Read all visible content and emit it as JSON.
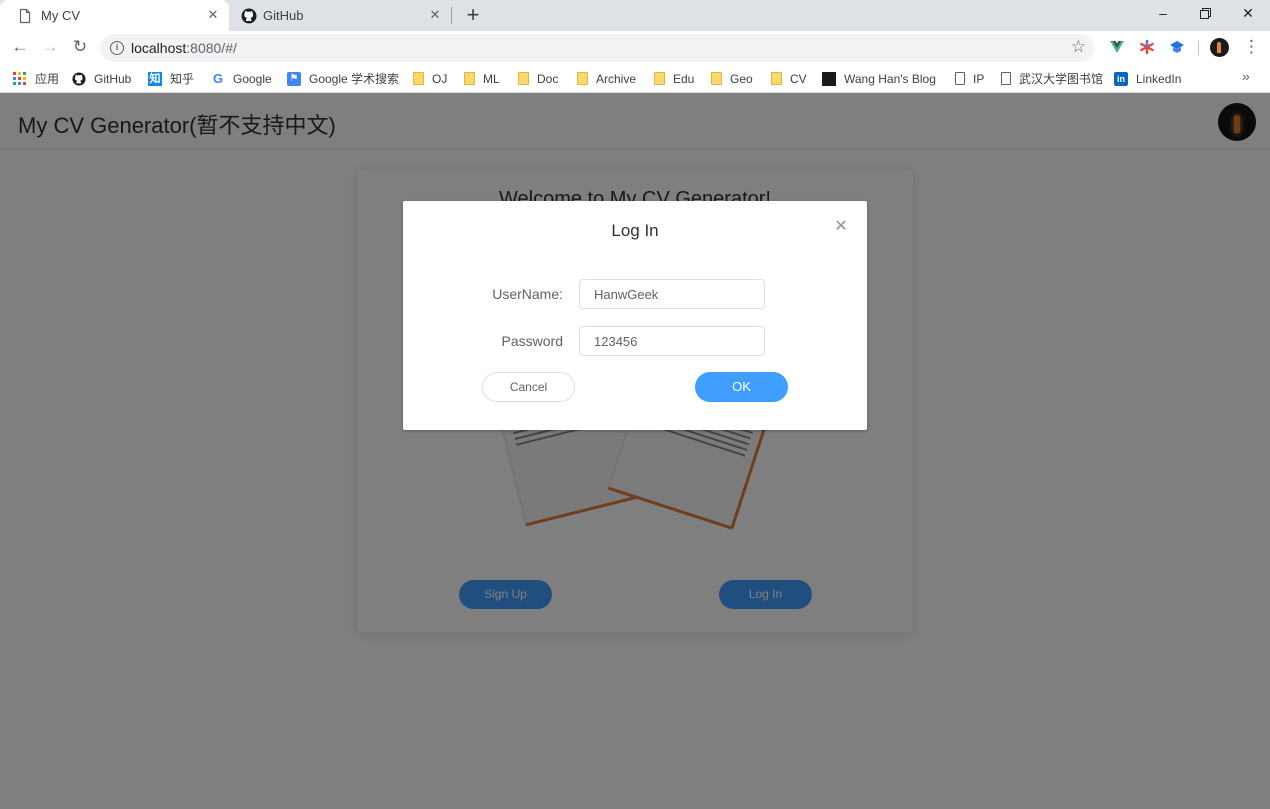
{
  "browser": {
    "tabs": [
      {
        "title": "My CV",
        "icon": "page-icon",
        "active": true
      },
      {
        "title": "GitHub",
        "icon": "github-icon",
        "active": false
      }
    ],
    "url_host": "localhost",
    "url_rest": ":8080/#/",
    "bookmarks": [
      {
        "label": "应用",
        "icon": "apps-grid-icon"
      },
      {
        "label": "GitHub",
        "icon": "github-icon"
      },
      {
        "label": "知乎",
        "icon": "zhihu-icon"
      },
      {
        "label": "Google",
        "icon": "google-icon"
      },
      {
        "label": "Google 学术搜索",
        "icon": "google-scholar-icon"
      },
      {
        "label": "OJ",
        "icon": "folder-icon"
      },
      {
        "label": "ML",
        "icon": "folder-icon"
      },
      {
        "label": "Doc",
        "icon": "folder-icon"
      },
      {
        "label": "Archive",
        "icon": "folder-icon"
      },
      {
        "label": "Edu",
        "icon": "folder-icon"
      },
      {
        "label": "Geo",
        "icon": "folder-icon"
      },
      {
        "label": "CV",
        "icon": "folder-icon"
      },
      {
        "label": "Wang Han's Blog",
        "icon": "blog-icon"
      },
      {
        "label": "IP",
        "icon": "page-icon"
      },
      {
        "label": "武汉大学图书馆",
        "icon": "page-icon"
      },
      {
        "label": "LinkedIn",
        "icon": "linkedin-icon"
      }
    ],
    "more_bookmarks": "»"
  },
  "app": {
    "title": "My CV Generator(暂不支持中文)",
    "welcome": "Welcome to My CV Generator!",
    "signup_label": "Sign Up",
    "login_label": "Log In"
  },
  "dialog": {
    "title": "Log In",
    "username_label": "UserName:",
    "username_value": "HanwGeek",
    "password_label": "Password",
    "password_value": "123456",
    "cancel_label": "Cancel",
    "ok_label": "OK"
  },
  "colors": {
    "primary": "#409eff",
    "overlay": "rgba(0,0,0,0.5)"
  }
}
